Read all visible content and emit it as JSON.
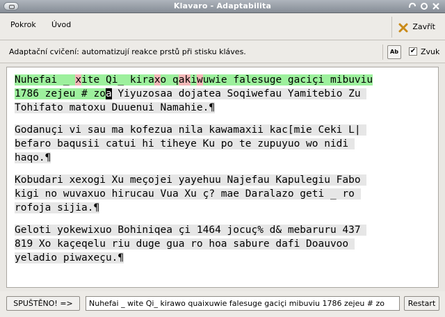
{
  "window": {
    "title": "Klavaro - Adaptabilita"
  },
  "menu": {
    "items": [
      "Pokrok",
      "Úvod"
    ],
    "close_label": "Zavřít"
  },
  "info": {
    "description": "Adaptační cvičení: automatizují reakce prstů při stisku kláves.",
    "sound_label": "Zvuk",
    "sound_checked": "✔",
    "font_button": "Ab"
  },
  "exercise": {
    "paragraphs": [
      {
        "lines": [
          [
            {
              "t": "Nuhefai _ ",
              "s": "done"
            },
            {
              "t": "x",
              "s": "err"
            },
            {
              "t": "ite Qi_ kira",
              "s": "done"
            },
            {
              "t": "x",
              "s": "err"
            },
            {
              "t": "o q",
              "s": "done"
            },
            {
              "t": "ak",
              "s": "err"
            },
            {
              "t": "i",
              "s": "done"
            },
            {
              "t": "w",
              "s": "err"
            },
            {
              "t": "uwie falesuge gaciçi mibuviu",
              "s": "done"
            }
          ],
          [
            {
              "t": "1786 zejeu # zo",
              "s": "done"
            },
            {
              "t": "a",
              "s": "cur"
            },
            {
              "t": " Yiyuzosaa dojatea Soqiwefau Yamitebio Zu ",
              "s": "t"
            }
          ],
          [
            {
              "t": "Tohifato matoxu Duuenui Namahie.¶",
              "s": "t"
            }
          ]
        ]
      },
      {
        "lines": [
          [
            {
              "t": "Godanuçi vi sau ma kofezua nila kawamaxii kac[mie Ceki L| ",
              "s": "t"
            }
          ],
          [
            {
              "t": "befaro baqusii catui hi tiheye Ku po te zupuyuo wo nidi ",
              "s": "t"
            }
          ],
          [
            {
              "t": "haqo.¶",
              "s": "t"
            }
          ]
        ]
      },
      {
        "lines": [
          [
            {
              "t": "Kobudari xexogi Xu meçojei yayehuu Najefau Kapulegiu Fabo ",
              "s": "t"
            }
          ],
          [
            {
              "t": "kigi no wuvaxuo hirucau Vua Xu ç? mae Daralazo geti _ ro ",
              "s": "t"
            }
          ],
          [
            {
              "t": "rofoja sijia.¶",
              "s": "t"
            }
          ]
        ]
      },
      {
        "lines": [
          [
            {
              "t": "Geloti yokewixuo Bohiniqea çi 1464 jocuç% d& mebaruru 437 ",
              "s": "t"
            }
          ],
          [
            {
              "t": "819 Xo kaçeqelu riu duge gua ro hoa sabure dafi Doauvoo ",
              "s": "t"
            }
          ],
          [
            {
              "t": "yeladio piwaxeçu.¶",
              "s": "t"
            }
          ]
        ]
      }
    ]
  },
  "bottom": {
    "status_label": "SPUŠTĚNO! =>",
    "typed_text": "Nuhefai _ wite Qi_ kirawo quaixuwie falesuge gaciçi mibuviu 1786 zejeu # zo",
    "restart_label": "Restart"
  },
  "colors": {
    "correct": "#9df09d",
    "error": "#f2b7b7",
    "pending": "#e6e6e6",
    "cursor": "#000000"
  }
}
